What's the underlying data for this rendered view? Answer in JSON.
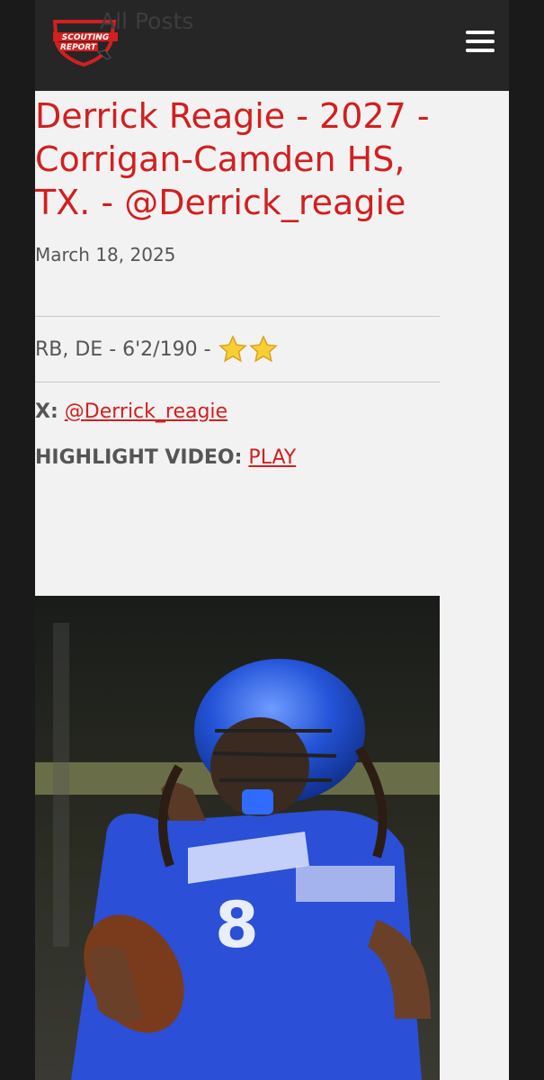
{
  "header": {
    "all_posts_label": "All Posts",
    "logo_text_line1": "SCOUTING",
    "logo_text_line2": "REPORT"
  },
  "post": {
    "title": "Derrick Reagie - 2027 - Corrigan-Camden HS, TX. - @Derrick_reagie",
    "date": "March 18, 2025",
    "position_line": "RB, DE - 6'2/190 -",
    "star_count": 2,
    "x_label": "X:",
    "x_handle": "@Derrick_reagie",
    "highlight_label": "HIGHLIGHT VIDEO:",
    "highlight_link": "PLAY"
  },
  "colors": {
    "accent": "#d21f1f",
    "topbar": "#262626",
    "page_bg": "#f2f2f2",
    "jersey": "#2b4fd6"
  },
  "icons": {
    "menu": "hamburger-icon",
    "star": "star-icon"
  }
}
